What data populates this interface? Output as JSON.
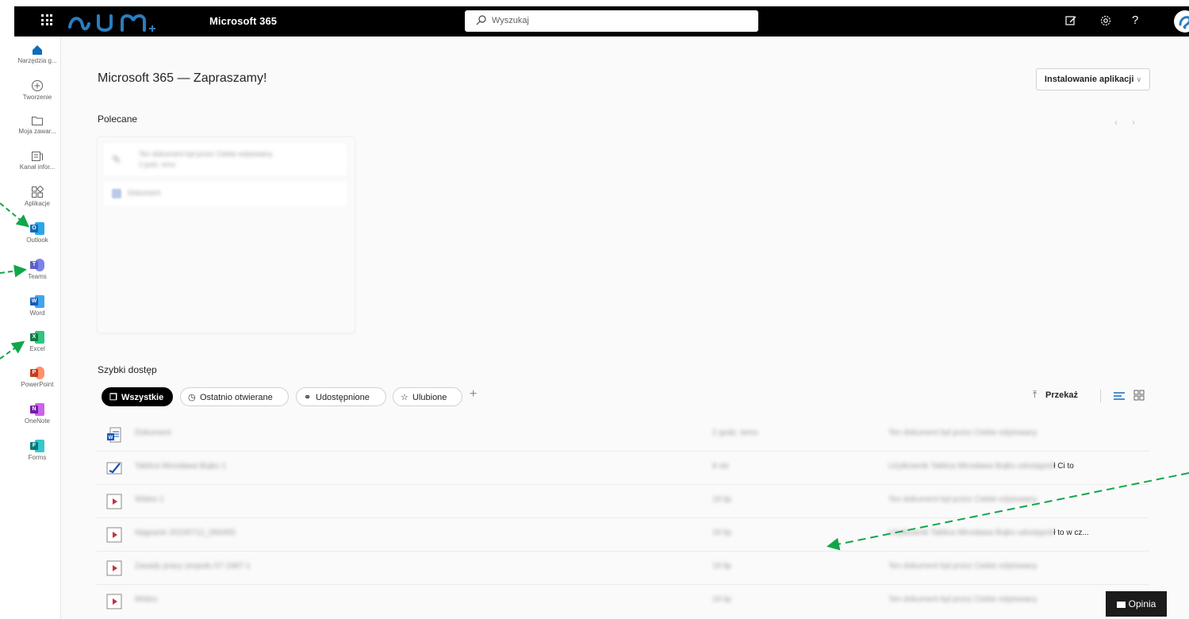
{
  "header": {
    "app_name": "Microsoft 365",
    "search_placeholder": "Wyszukaj"
  },
  "rail": {
    "items": [
      {
        "label": "Narzędzia g..."
      },
      {
        "label": "Tworzenie"
      },
      {
        "label": "Moja zawar..."
      },
      {
        "label": "Kanał infor..."
      },
      {
        "label": "Aplikacje"
      },
      {
        "label": "Outlook",
        "letter": "O",
        "color": "#0f6cbd"
      },
      {
        "label": "Teams",
        "letter": "T",
        "color": "#5b5fc7"
      },
      {
        "label": "Word",
        "letter": "W",
        "color": "#185abd"
      },
      {
        "label": "Excel",
        "letter": "X",
        "color": "#107c41"
      },
      {
        "label": "PowerPoint",
        "letter": "P",
        "color": "#c43e1c"
      },
      {
        "label": "OneNote",
        "letter": "N",
        "color": "#7719aa"
      },
      {
        "label": "Forms",
        "letter": "F",
        "color": "#027b7a"
      }
    ]
  },
  "main": {
    "welcome": "Microsoft 365 — Zapraszamy!",
    "install_button": "Instalowanie aplikacji",
    "recommended_title": "Polecane",
    "recommended": [
      {
        "title": "Ten dokument był przez Ciebie edytowany",
        "subtitle": "2 godz. temu"
      },
      {
        "title": "Dokument"
      }
    ],
    "quick_access_title": "Szybki dostęp",
    "filters": [
      {
        "label": "Wszystkie",
        "active": true
      },
      {
        "label": "Ostatnio otwierane"
      },
      {
        "label": "Udostępnione"
      },
      {
        "label": "Ulubione"
      }
    ],
    "upload_label": "Przekaż",
    "files": [
      {
        "type": "word",
        "name": "Dokument",
        "date": "2 godz. temu",
        "activity": "Ten dokument był przez Ciebie edytowany",
        "activity_tail": ""
      },
      {
        "type": "whiteboard",
        "name": "Tablica Mirosława Bojko 1",
        "date": "8 sie",
        "activity": "Użytkownik Tablica Mirosława Bojko udostępnił",
        "activity_tail": "ł Ci to"
      },
      {
        "type": "video",
        "name": "Wideo 1",
        "date": "19 lip",
        "activity": "Ten dokument był przez Ciebie edytowany",
        "activity_tail": ""
      },
      {
        "type": "video",
        "name": "Nagranie 20230712_083455",
        "date": "19 lip",
        "activity": "Użytkownik Tablica Mirosława Bojko udostępnił",
        "activity_tail": "ł to w cz..."
      },
      {
        "type": "video",
        "name": "Zasady pracy zespołu 07-1987-1",
        "date": "19 lip",
        "activity": "Ten dokument był przez Ciebie edytowany",
        "activity_tail": ""
      },
      {
        "type": "video",
        "name": "Wideo",
        "date": "19 lip",
        "activity": "Ten dokument był przez Ciebie edytowany",
        "activity_tail": ""
      }
    ]
  },
  "feedback_button": "Opinia",
  "colors": {
    "accent": "#0f6cbd",
    "annotation_arrow": "#11a64a",
    "video": "#c4314b"
  }
}
